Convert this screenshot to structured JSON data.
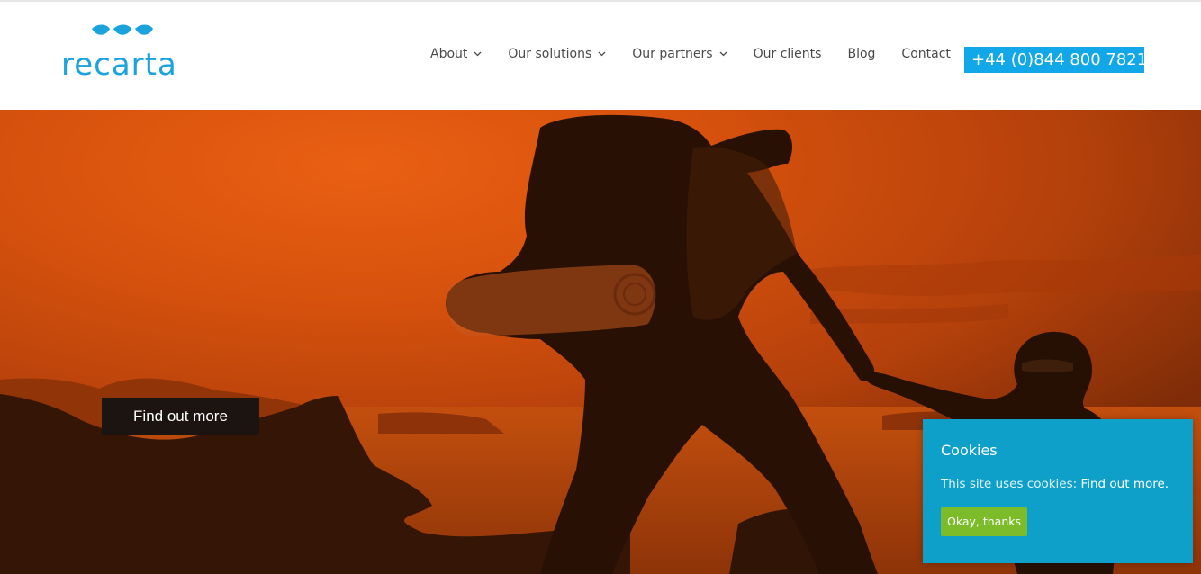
{
  "brand": {
    "name": "recarta",
    "color": "#1aa3dc",
    "logo_icon": "three-leaves-icon"
  },
  "nav": {
    "items": [
      {
        "label": "About",
        "has_dropdown": true
      },
      {
        "label": "Our solutions",
        "has_dropdown": true
      },
      {
        "label": "Our partners",
        "has_dropdown": true
      },
      {
        "label": "Our clients",
        "has_dropdown": false
      },
      {
        "label": "Blog",
        "has_dropdown": false
      },
      {
        "label": "Contact",
        "has_dropdown": false
      }
    ],
    "text_color": "#4a4a4a"
  },
  "phone": {
    "label": "+44 (0)844 800 7821",
    "bg_color": "#12a7e8"
  },
  "hero": {
    "cta_label": "Find out more",
    "tint_color": "#c2470f"
  },
  "cookie": {
    "title": "Cookies",
    "text": "This site uses cookies: ",
    "link_text": "Find out more.",
    "button_label": "Okay, thanks",
    "bg_color": "#0ea0c9",
    "button_color": "#7cbc2a"
  }
}
